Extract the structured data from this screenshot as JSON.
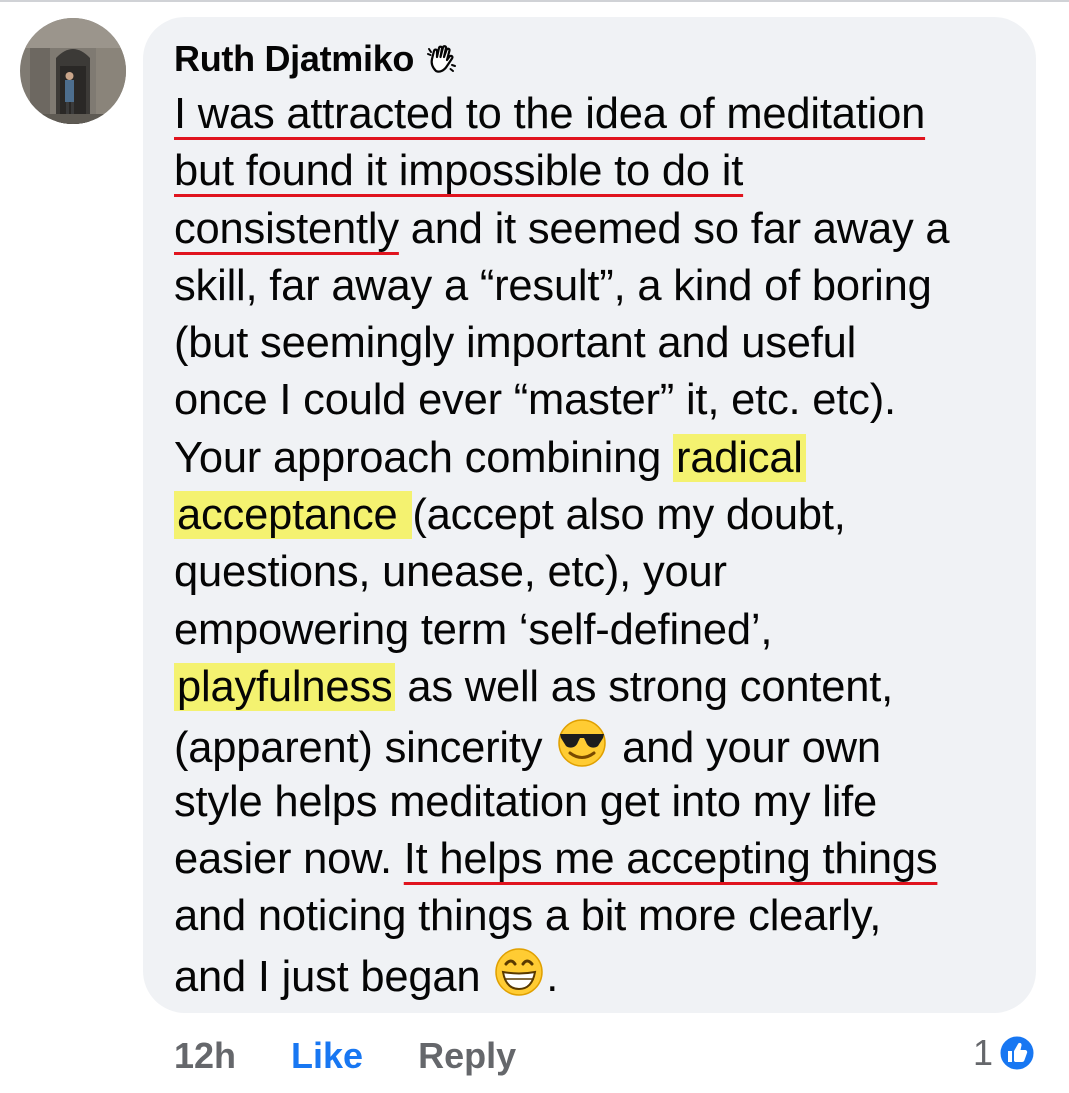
{
  "comment": {
    "author": "Ruth Djatmiko",
    "badge_icon": "waving-hand-icon",
    "lines": [
      [
        {
          "t": "I was attracted to the idea of meditation",
          "s": "u"
        }
      ],
      [
        {
          "t": "but found it impossible to do it",
          "s": "u"
        }
      ],
      [
        {
          "t": "consistently",
          "s": "u"
        },
        {
          "t": " and it seemed so far away a"
        }
      ],
      [
        {
          "t": "skill, far away a “result”, a kind of boring"
        }
      ],
      [
        {
          "t": "(but seemingly important and useful"
        }
      ],
      [
        {
          "t": "once I could ever “master” it, etc. etc)."
        }
      ],
      [
        {
          "t": "Your approach combining "
        },
        {
          "t": "radical",
          "s": "h"
        }
      ],
      [
        {
          "t": "acceptance ",
          "s": "h"
        },
        {
          "t": "(accept also my doubt,"
        }
      ],
      [
        {
          "t": "questions, unease, etc), your"
        }
      ],
      [
        {
          "t": "empowering term ‘self-defined’,"
        }
      ],
      [
        {
          "t": "playfulness",
          "s": "h"
        },
        {
          "t": " as well as strong content,"
        }
      ],
      [
        {
          "t": "(apparent) sincerity "
        },
        {
          "e": "sunglasses-emoji-icon"
        },
        {
          "t": " and your own"
        }
      ],
      [
        {
          "t": "style helps meditation get into my life"
        }
      ],
      [
        {
          "t": "easier now. "
        },
        {
          "t": "It helps me accepting things",
          "s": "u"
        }
      ],
      [
        {
          "t": "and noticing things a bit more clearly,"
        }
      ],
      [
        {
          "t": "and I just began "
        },
        {
          "e": "grinning-emoji-icon"
        },
        {
          "t": "."
        }
      ]
    ]
  },
  "footer": {
    "time": "12h",
    "like": "Like",
    "reply": "Reply"
  },
  "reactions": {
    "count": "1",
    "icon": "thumbs-up-icon"
  },
  "colors": {
    "highlight": "#f4f270",
    "underline": "#e0141e",
    "like_blue": "#1877f2",
    "bubble": "#f0f2f5"
  }
}
